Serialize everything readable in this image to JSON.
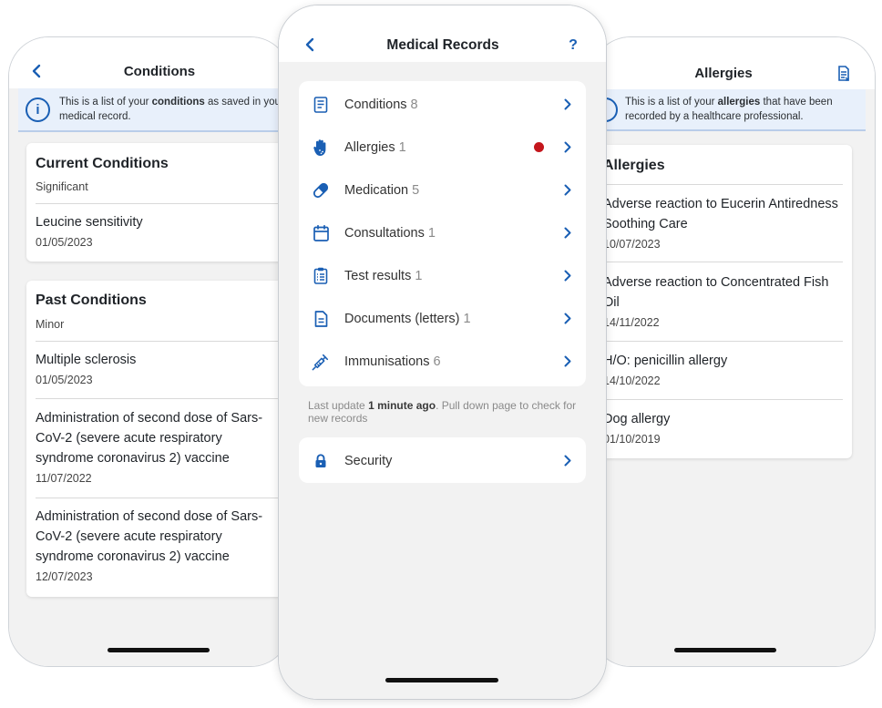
{
  "left": {
    "title": "Conditions",
    "banner": {
      "prefix": "This is a list of your ",
      "bold": "conditions",
      "suffix": " as saved in your medical record."
    },
    "current": {
      "heading": "Current Conditions",
      "subheading": "Significant",
      "items": [
        {
          "title": "Leucine sensitivity",
          "date": "01/05/2023"
        }
      ]
    },
    "past": {
      "heading": "Past Conditions",
      "subheading": "Minor",
      "items": [
        {
          "title": "Multiple sclerosis",
          "date": "01/05/2023"
        },
        {
          "title": "Administration of second dose of Sars-CoV-2 (severe acute respiratory syndrome coronavirus 2) vaccine",
          "date": "11/07/2022"
        },
        {
          "title": "Administration of second dose of Sars-CoV-2 (severe acute respiratory syndrome coronavirus 2) vaccine",
          "date": "12/07/2023"
        }
      ]
    }
  },
  "center": {
    "title": "Medical Records",
    "help_label": "?",
    "menu": [
      {
        "label": "Conditions",
        "count": "8",
        "icon": "document-list-icon"
      },
      {
        "label": "Allergies",
        "count": "1",
        "icon": "allergy-hand-icon",
        "alert": true
      },
      {
        "label": "Medication",
        "count": "5",
        "icon": "pill-icon"
      },
      {
        "label": "Consultations",
        "count": "1",
        "icon": "calendar-icon"
      },
      {
        "label": "Test results",
        "count": "1",
        "icon": "clipboard-icon"
      },
      {
        "label": "Documents (letters)",
        "count": "1",
        "icon": "document-icon"
      },
      {
        "label": "Immunisations",
        "count": "6",
        "icon": "syringe-icon"
      }
    ],
    "update": {
      "prefix": "Last update ",
      "bold": "1 minute ago",
      "suffix": ". Pull down page to check for new records"
    },
    "security": {
      "label": "Security",
      "icon": "lock-icon"
    }
  },
  "right": {
    "title": "Allergies",
    "banner": {
      "prefix": "This is a list of your ",
      "bold": "allergies",
      "suffix": " that have been recorded by a healthcare professional."
    },
    "heading": "Allergies",
    "items": [
      {
        "title": "Adverse reaction to Eucerin Antiredness Soothing Care",
        "date": "10/07/2023"
      },
      {
        "title": "Adverse reaction to Concentrated Fish Oil",
        "date": "14/11/2022"
      },
      {
        "title": "H/O: penicillin allergy",
        "date": "14/10/2022"
      },
      {
        "title": "Dog allergy",
        "date": "01/10/2019"
      }
    ]
  },
  "colors": {
    "accent": "#1a5fb4",
    "alert": "#c4161c",
    "background": "#f2f2f2"
  }
}
